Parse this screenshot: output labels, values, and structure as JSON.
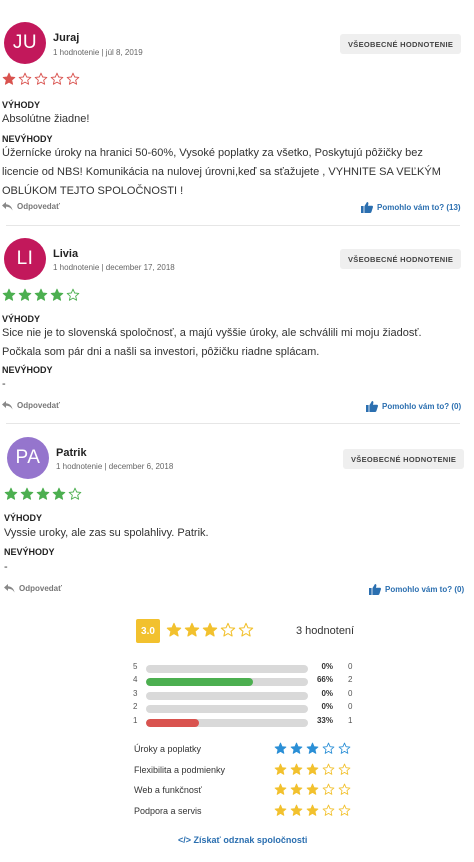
{
  "reviews": [
    {
      "initials": "JU",
      "avatar_color": "#c2185b",
      "name": "Juraj",
      "meta": "1 hodnotenie | júl 8, 2019",
      "badge": "VŠEOBECNÉ HODNOTENIE",
      "rating": 1,
      "star_color": "#d9534f",
      "pros_label": "VÝHODY",
      "pros_text": "Absolútne žiadne!",
      "cons_label": "NEVÝHODY",
      "cons_text": "Úžernícke úroky na hranici 50-60%, Vysoké poplatky za všetko, Poskytujú pôžičky bez licencie od NBS! Komunikácia na nulovej úrovni,keď sa sťažujete , VYHNITE SA VEĽKÝM OBLÚKOM TEJTO SPOLOČNOSTI !",
      "reply": "Odpovedať",
      "helpful": "Pomohlo vám to? (13)"
    },
    {
      "initials": "LI",
      "avatar_color": "#c2185b",
      "name": "Livia",
      "meta": "1 hodnotenie | december 17, 2018",
      "badge": "VŠEOBECNÉ HODNOTENIE",
      "rating": 4,
      "star_color": "#4caf50",
      "pros_label": "VÝHODY",
      "pros_text": "Sice nie je to slovenská spoločnosť, a majú vyššie úroky, ale schválili mi moju žiadosť. Počkala som pár dni a našli sa investori, pôžičku riadne splácam.",
      "cons_label": "NEVÝHODY",
      "cons_text": "-",
      "reply": "Odpovedať",
      "helpful": "Pomohlo vám to? (0)"
    },
    {
      "initials": "PA",
      "avatar_color": "#9575cd",
      "name": "Patrik",
      "meta": "1 hodnotenie | december 6, 2018",
      "badge": "VŠEOBECNÉ HODNOTENIE",
      "rating": 4,
      "star_color": "#4caf50",
      "pros_label": "VÝHODY",
      "pros_text": "Vyssie uroky, ale zas su spolahlivy. Patrik.",
      "cons_label": "NEVÝHODY",
      "cons_text": "-",
      "reply": "Odpovedať",
      "helpful": "Pomohlo vám to? (0)"
    }
  ],
  "summary": {
    "score": "3.0",
    "rating": 3,
    "star_color": "#f2c12e",
    "count_text": "3 hodnotení",
    "distribution": [
      {
        "stars": "5",
        "percent": 0,
        "percent_text": "0%",
        "count": "0",
        "color": "#d9d9d9"
      },
      {
        "stars": "4",
        "percent": 66,
        "percent_text": "66%",
        "count": "2",
        "color": "#4caf50"
      },
      {
        "stars": "3",
        "percent": 0,
        "percent_text": "0%",
        "count": "0",
        "color": "#d9d9d9"
      },
      {
        "stars": "2",
        "percent": 0,
        "percent_text": "0%",
        "count": "0",
        "color": "#d9d9d9"
      },
      {
        "stars": "1",
        "percent": 33,
        "percent_text": "33%",
        "count": "1",
        "color": "#d9534f"
      }
    ],
    "categories": [
      {
        "label": "Úroky a poplatky",
        "rating": 3,
        "color": "#2b8fd6"
      },
      {
        "label": "Flexibilita a podmienky",
        "rating": 3,
        "color": "#f2c12e"
      },
      {
        "label": "Web a funkčnosť",
        "rating": 3,
        "color": "#f2c12e"
      },
      {
        "label": "Podpora a servis",
        "rating": 3,
        "color": "#f2c12e"
      }
    ],
    "badge_link": "</> Získať odznak spoločnosti"
  }
}
